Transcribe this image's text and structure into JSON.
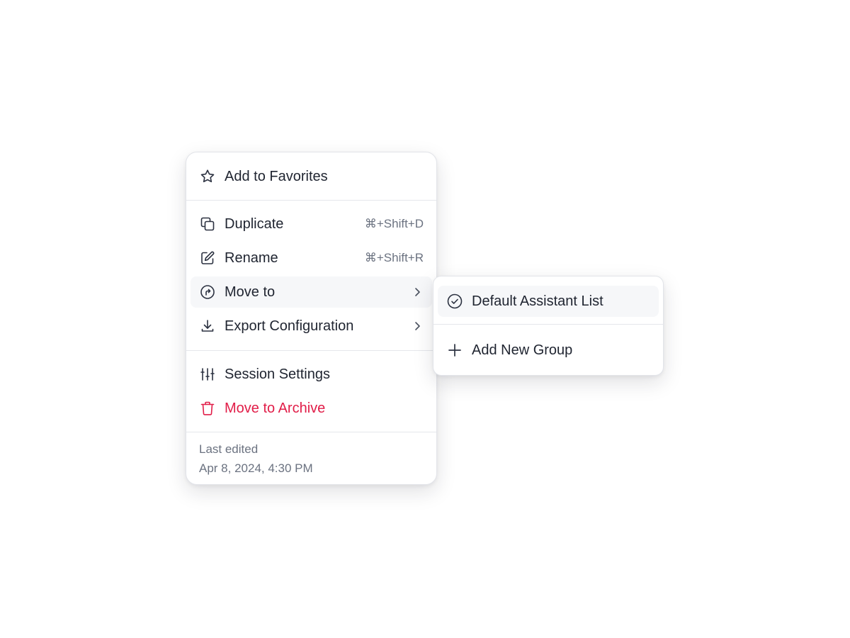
{
  "menu": {
    "favorite": {
      "label": "Add to Favorites",
      "icon": "star-icon"
    },
    "duplicate": {
      "label": "Duplicate",
      "shortcut": "⌘+Shift+D",
      "icon": "copy-icon"
    },
    "rename": {
      "label": "Rename",
      "shortcut": "⌘+Shift+R",
      "icon": "edit-icon"
    },
    "move_to": {
      "label": "Move to",
      "icon": "move-icon"
    },
    "export": {
      "label": "Export Configuration",
      "icon": "download-icon"
    },
    "settings": {
      "label": "Session Settings",
      "icon": "sliders-icon"
    },
    "archive": {
      "label": "Move to Archive",
      "icon": "trash-icon"
    },
    "footer": {
      "caption": "Last edited",
      "timestamp": "Apr 8, 2024, 4:30 PM"
    }
  },
  "submenu": {
    "default_list": {
      "label": "Default Assistant List",
      "icon": "check-circle-icon"
    },
    "add_group": {
      "label": "Add New Group",
      "icon": "plus-icon"
    }
  },
  "colors": {
    "text": "#1f2430",
    "muted": "#6b7280",
    "danger": "#e11d48",
    "hover": "#f6f7f9",
    "border": "#e5e7eb"
  }
}
